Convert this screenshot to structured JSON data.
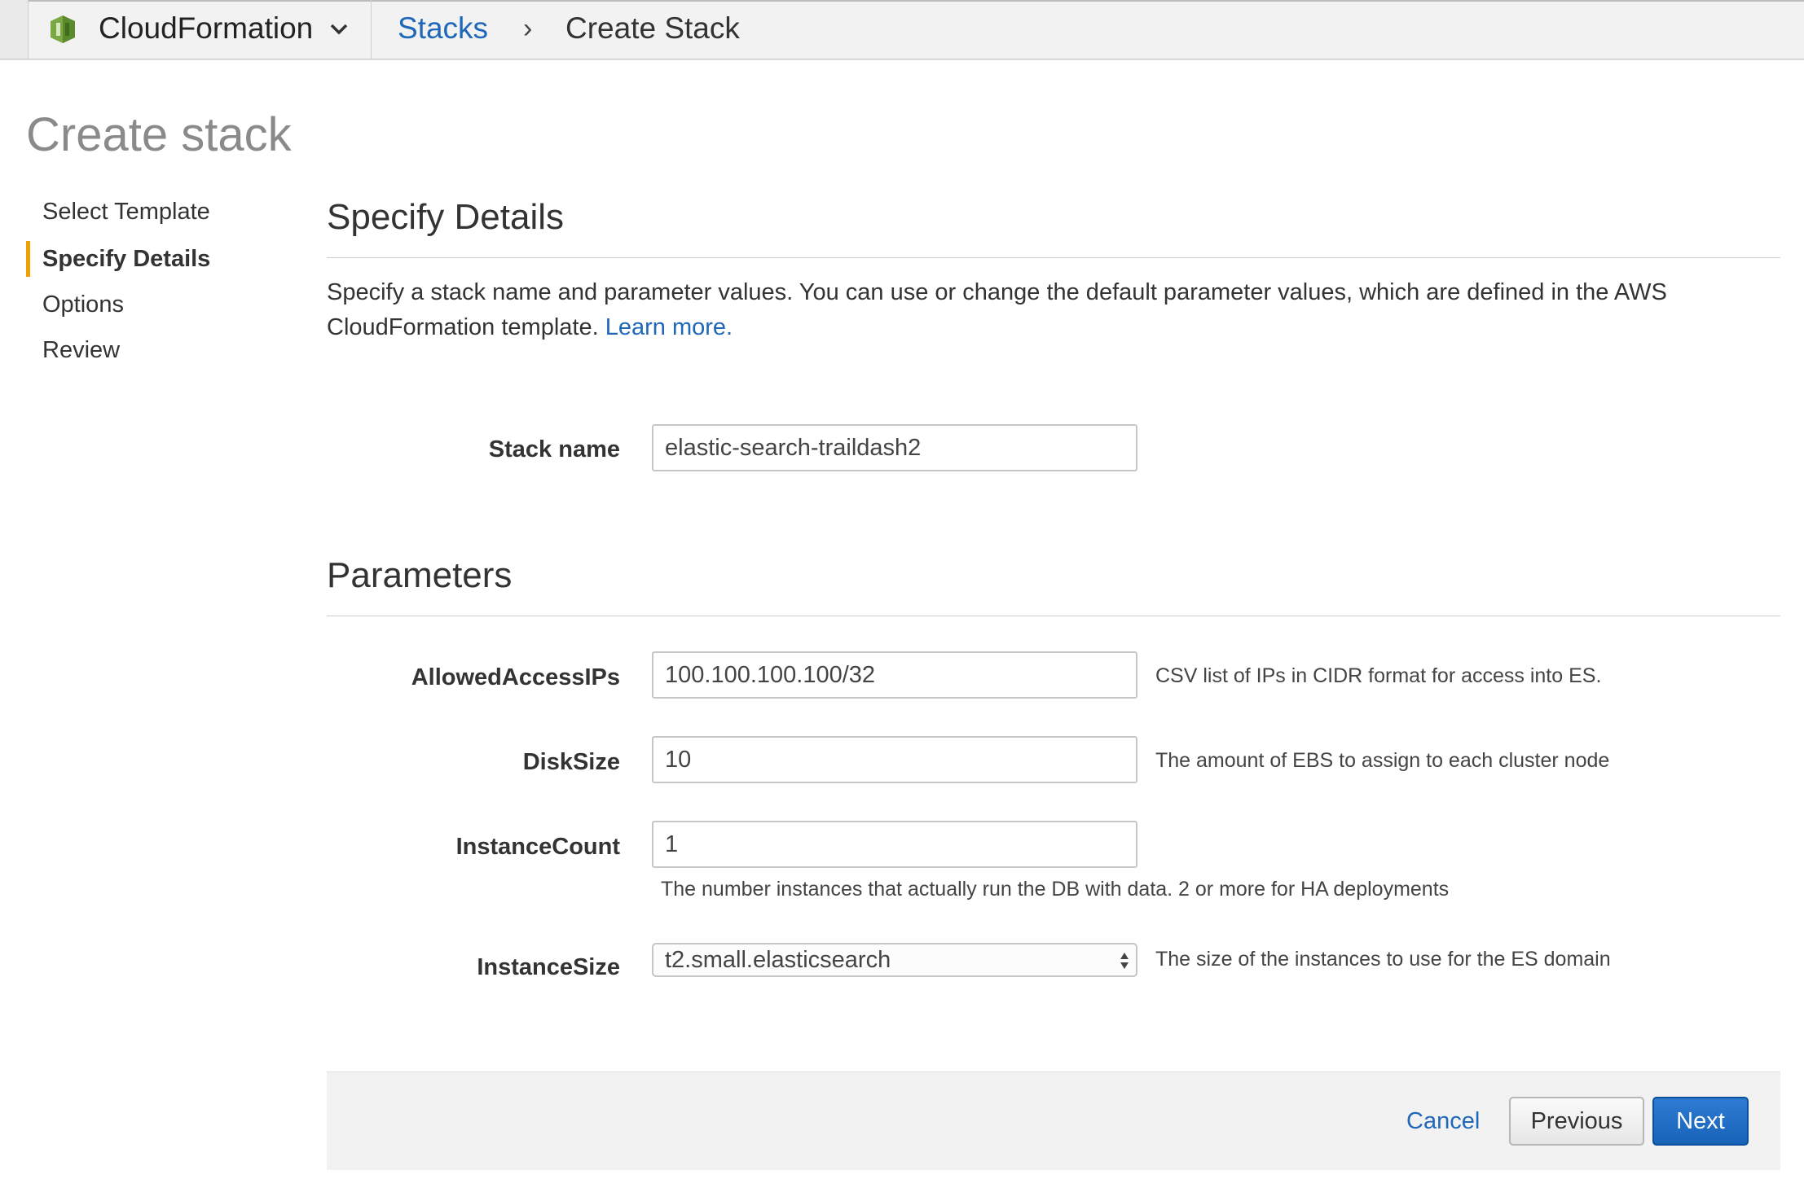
{
  "topbar": {
    "service_name": "CloudFormation",
    "service_icon": "cloudformation-logo-icon",
    "breadcrumb": {
      "stacks": "Stacks",
      "separator": "›",
      "current": "Create Stack"
    }
  },
  "page": {
    "title": "Create stack"
  },
  "nav": {
    "items": [
      {
        "label": "Select Template",
        "active": false
      },
      {
        "label": "Specify Details",
        "active": true
      },
      {
        "label": "Options",
        "active": false
      },
      {
        "label": "Review",
        "active": false
      }
    ]
  },
  "details": {
    "heading": "Specify Details",
    "intro_text": "Specify a stack name and parameter values. You can use or change the default parameter values, which are defined in the AWS CloudFormation template.",
    "learn_more": "Learn more.",
    "stack_name_label": "Stack name",
    "stack_name_value": "elastic-search-traildash2"
  },
  "parameters": {
    "heading": "Parameters",
    "allowed_ips": {
      "label": "AllowedAccessIPs",
      "value": "100.100.100.100/32",
      "help": "CSV list of IPs in CIDR format for access into ES."
    },
    "disk_size": {
      "label": "DiskSize",
      "value": "10",
      "help": "The amount of EBS to assign to each cluster node"
    },
    "instance_count": {
      "label": "InstanceCount",
      "value": "1",
      "help": "The number instances that actually run the DB with data. 2 or more for HA deployments"
    },
    "instance_size": {
      "label": "InstanceSize",
      "value": "t2.small.elasticsearch",
      "help": "The size of the instances to use for the ES domain"
    }
  },
  "footer": {
    "cancel": "Cancel",
    "previous": "Previous",
    "next": "Next"
  },
  "colors": {
    "link": "#1e67b9",
    "primary_button": "#1663b8",
    "active_indicator": "#f0a000",
    "service_icon_green": "#6b9b37"
  }
}
